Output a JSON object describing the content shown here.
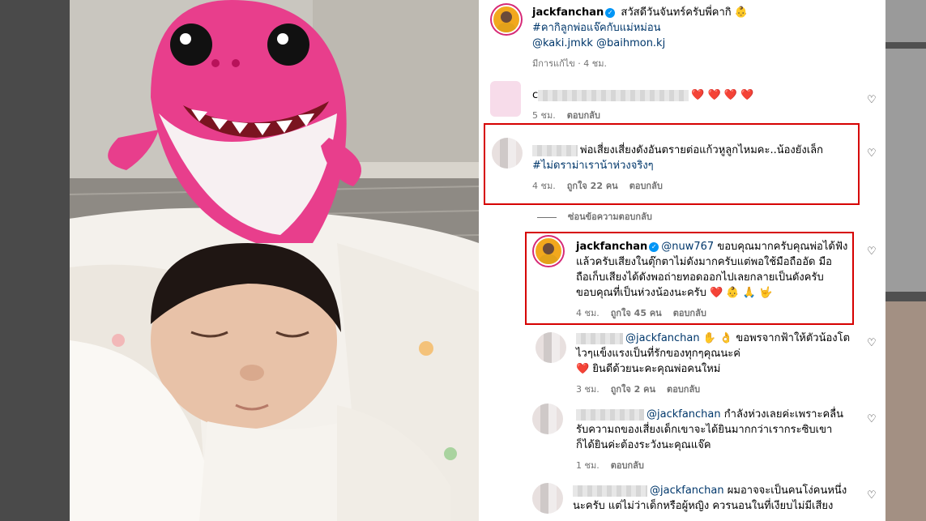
{
  "caption": {
    "username": "jackfanchan",
    "line1": "สวัสดีวันจันทร์ครับพี่คากิ 👶",
    "hashtag": "#คากิลูกพ่อแจ๊คกับแม่หม่อน",
    "mentions": "@kaki.jmkk @baihmon.kj",
    "edited_time": "มีการแก้ไข · 4 ชม."
  },
  "comments": [
    {
      "text_suffix": "❤️ ❤️ ❤️ ❤️",
      "time": "5 ชม.",
      "reply_label": "ตอบกลับ"
    },
    {
      "line1": "พ่อเสี่ยงเสี่ยงดังอันตรายต่อแก้วหูลูกไหมคะ..น้องยังเล็ก",
      "line2": "#ไม่ดราม่าเราน้าห่วงจริงๆ",
      "time": "4 ชม.",
      "likes": "ถูกใจ 22 คน",
      "reply_label": "ตอบกลับ"
    }
  ],
  "hide_replies_label": "ซ่อนข้อความตอบกลับ",
  "replies": [
    {
      "username": "jackfanchan",
      "mention": "@nuw767",
      "line1": " ขอบคุณมากครับคุณพ่อได้ฟัง",
      "line2": "แล้วครับเสียงในตุ๊กตาไม่ดังมากครับแต่พอใช้มือถืออัด มือ",
      "line3": "ถือเก็บเสียงได้ดังพอถ่ายทอดออกไปเลยกลายเป็นดังครับ",
      "line4": "ขอบคุณที่เป็นห่วงน้องนะครับ ❤️ 👶 🙏 🤟",
      "time": "4 ชม.",
      "likes": "ถูกใจ 45 คน",
      "reply_label": "ตอบกลับ"
    },
    {
      "mention": "@jackfanchan",
      "line1": " ✋ 👌 ขอพรจากฟ้าให้ตัวน้องโต",
      "line2": "ไวๆแข็งแรงเป็นที่รักของทุกๆคุณนะค่",
      "line3": "❤️ ยินดีด้วยนะคะคุณพ่อคนใหม่",
      "time": "3 ชม.",
      "likes": "ถูกใจ 2 คน",
      "reply_label": "ตอบกลับ"
    },
    {
      "mention": "@jackfanchan",
      "line1": " กำลังห่วงเลยค่ะเพราะคลื่น",
      "line2": "รับความถของเสี่ยงเด็กเขาจะได้ยินมากกว่าเรากระซิบเขา",
      "line3": "ก็ได้ยินค่ะต้องระวังนะคุณแจ๊ค",
      "time": "1 ชม.",
      "reply_label": "ตอบกลับ"
    },
    {
      "mention": "@jackfanchan",
      "line1": " ผมอาจจะเป็นคนโง่คนหนึ่ง",
      "line2": "นะครับ แต่ไม่ว่าเด็กหรือผู้หญิง ควรนอนในที่เงียบไม่มีเสียง"
    }
  ],
  "colors": {
    "highlight": "#d60000",
    "link": "#00376b",
    "verified": "#0095f6",
    "meta": "#737373"
  }
}
